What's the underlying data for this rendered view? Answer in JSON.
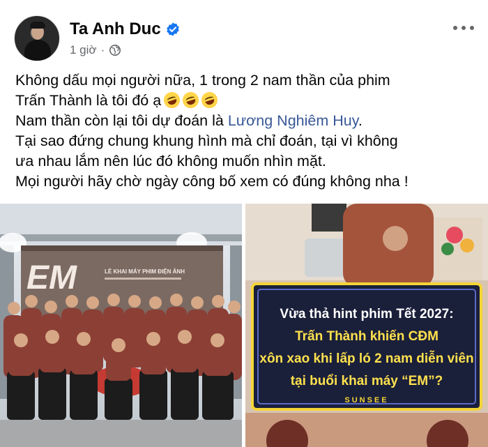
{
  "post": {
    "author_name": "Ta Anh Duc",
    "timestamp": "1 giờ",
    "separator": "·",
    "text": {
      "line1": "Không dấu mọi người nữa, 1 trong 2 nam thần của phim",
      "line2": "Trấn Thành là tôi đó ạ",
      "line3_prefix": "Nam thần còn lại tôi dự đoán là ",
      "line3_mention": "Lương Nghiêm Huy",
      "line3_suffix": ".",
      "line4": "Tại sao đứng chung khung hình mà chỉ đoán, tại vì không",
      "line5": "ưa nhau lắm nên lúc đó không muốn nhìn mặt.",
      "line6": "Mọi người hãy chờ ngày công bố xem có đúng không nha !"
    },
    "emojis": [
      "rolling-on-floor-laughing",
      "rolling-on-floor-laughing",
      "rolling-on-floor-laughing"
    ]
  },
  "photo_left": {
    "banner_logo": "EM",
    "banner_line1": "LỄ KHAI MÁY PHIM ĐIỆN ẢNH"
  },
  "photo_right": {
    "headline_line1": "Vừa thả hint phim Tết 2027:",
    "headline_line2": "Trấn Thành khiến CĐM",
    "headline_line3": "xôn xao khi lấp ló 2 nam diễn viên",
    "headline_line4": "tại buổi khai máy “EM”?",
    "brand": "SUNSEE"
  },
  "colors": {
    "link": "#385898",
    "verified": "#1877f2",
    "meta_gray": "#65676b",
    "headline_yellow": "#ffe14d"
  }
}
